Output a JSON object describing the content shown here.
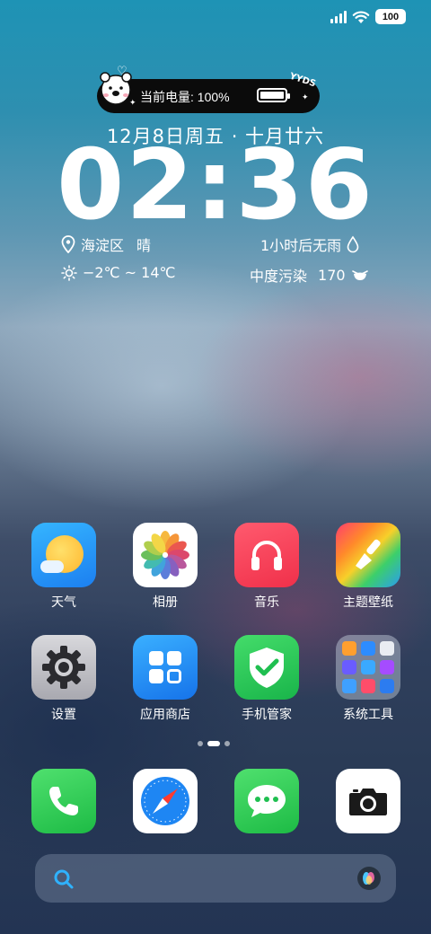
{
  "status_bar": {
    "battery_level": "100"
  },
  "battery_widget": {
    "label": "当前电量: 100%",
    "sticker_text": "YYDS"
  },
  "lockscreen": {
    "date": "12月8日周五 · 十月廿六",
    "time": "02:36",
    "location": "海淀区",
    "weather": "晴",
    "rain_forecast": "1小时后无雨",
    "temperature_range": "−2℃ ~ 14℃",
    "air_quality_label": "中度污染",
    "air_quality_value": "170"
  },
  "apps_row1": [
    {
      "label": "天气"
    },
    {
      "label": "相册"
    },
    {
      "label": "音乐"
    },
    {
      "label": "主题壁纸"
    }
  ],
  "apps_row2": [
    {
      "label": "设置"
    },
    {
      "label": "应用商店"
    },
    {
      "label": "手机管家"
    },
    {
      "label": "系统工具"
    }
  ],
  "page_indicator": {
    "pages": 3,
    "current": 2
  },
  "dock": [
    {
      "icon": "phone-icon"
    },
    {
      "icon": "compass-icon"
    },
    {
      "icon": "messages-icon"
    },
    {
      "icon": "camera-icon"
    }
  ],
  "colors": {
    "accent_blue": "#1e90ff",
    "green": "#34c759",
    "red": "#ff3b5c"
  }
}
